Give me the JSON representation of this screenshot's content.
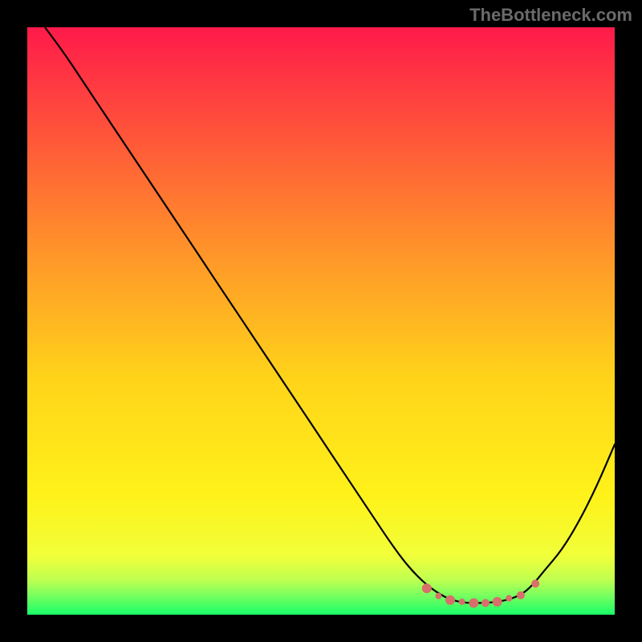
{
  "chart_data": {
    "type": "line",
    "title": "",
    "xlabel": "",
    "ylabel": "",
    "x_range": [
      0,
      100
    ],
    "y_range": [
      0,
      100
    ],
    "watermark": "TheBottleneck.com",
    "background_gradient": {
      "stops": [
        {
          "offset": 0.0,
          "color": "#ff1a4a"
        },
        {
          "offset": 0.2,
          "color": "#ff5a38"
        },
        {
          "offset": 0.4,
          "color": "#ff9a28"
        },
        {
          "offset": 0.6,
          "color": "#ffd41a"
        },
        {
          "offset": 0.8,
          "color": "#fff21a"
        },
        {
          "offset": 0.9,
          "color": "#f0ff3a"
        },
        {
          "offset": 0.94,
          "color": "#c0ff50"
        },
        {
          "offset": 0.97,
          "color": "#70ff60"
        },
        {
          "offset": 1.0,
          "color": "#18ff68"
        }
      ]
    },
    "series": [
      {
        "name": "bottleneck-curve",
        "color": "#000000",
        "width": 2.2,
        "x": [
          3,
          6,
          10,
          14,
          18,
          22,
          26,
          30,
          34,
          38,
          42,
          46,
          50,
          54,
          58,
          62,
          65,
          68,
          71,
          73,
          75,
          78,
          81,
          84,
          86,
          88,
          91,
          94,
          97,
          100
        ],
        "y": [
          100,
          96,
          90,
          84,
          78,
          72,
          66,
          60,
          54,
          48,
          42,
          36,
          30,
          24,
          18,
          12,
          8,
          5,
          3,
          2.3,
          2,
          2,
          2.3,
          3.3,
          5,
          7.5,
          11,
          16,
          22,
          29
        ]
      }
    ],
    "markers": {
      "name": "optimal-range-markers",
      "color": "#d86f6a",
      "radius": 5,
      "items": [
        {
          "x": 68,
          "y": 4.5,
          "r": 6
        },
        {
          "x": 70,
          "y": 3.2,
          "r": 4
        },
        {
          "x": 72,
          "y": 2.5,
          "r": 6
        },
        {
          "x": 74,
          "y": 2.2,
          "r": 4
        },
        {
          "x": 76,
          "y": 2.0,
          "r": 6
        },
        {
          "x": 78,
          "y": 2.0,
          "r": 5
        },
        {
          "x": 80,
          "y": 2.2,
          "r": 6
        },
        {
          "x": 82,
          "y": 2.8,
          "r": 4
        },
        {
          "x": 84,
          "y": 3.3,
          "r": 5
        },
        {
          "x": 86.5,
          "y": 5.3,
          "r": 5
        }
      ]
    }
  }
}
